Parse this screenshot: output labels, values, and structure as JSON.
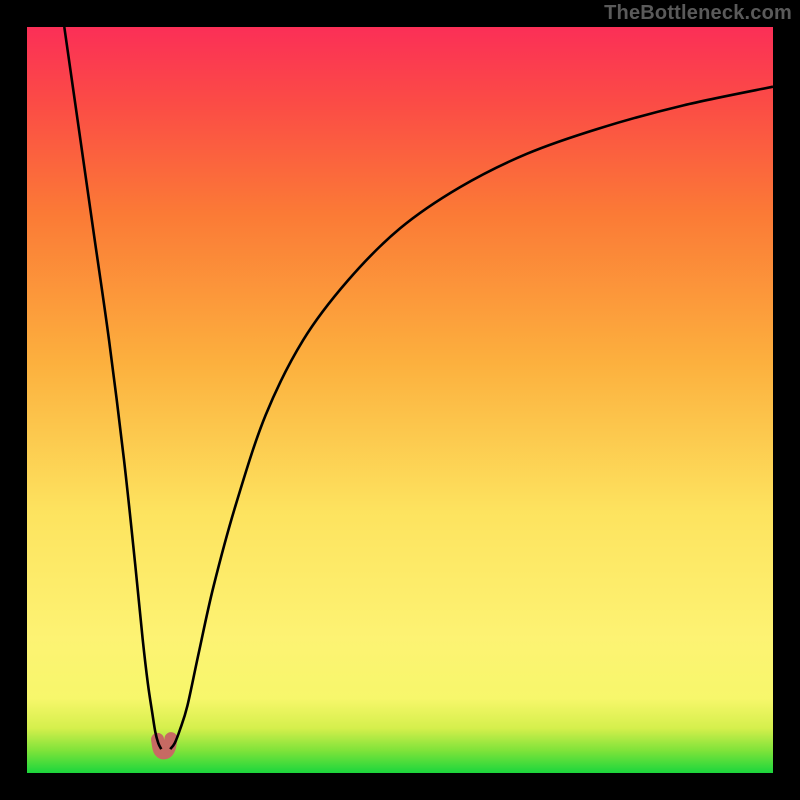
{
  "watermark": "TheBottleneck.com",
  "chart_data": {
    "type": "line",
    "title": "",
    "xlabel": "",
    "ylabel": "",
    "xlim": [
      0,
      100
    ],
    "ylim": [
      0,
      100
    ],
    "grid": false,
    "legend": false,
    "series": [
      {
        "name": "left-branch",
        "x": [
          5,
          7,
          9,
          11,
          13,
          14.5,
          15.5,
          16.2,
          16.8,
          17.2,
          17.6,
          18.0
        ],
        "y": [
          100,
          86,
          72,
          58,
          42,
          28,
          18,
          12,
          8,
          5.5,
          4,
          3.2
        ]
      },
      {
        "name": "right-branch",
        "x": [
          19.2,
          19.8,
          20.5,
          21.5,
          23,
          25,
          28,
          32,
          37,
          43,
          50,
          58,
          67,
          77,
          88,
          100
        ],
        "y": [
          3.2,
          4,
          5.8,
          9,
          16,
          25,
          36,
          48,
          58,
          66,
          73,
          78.5,
          83,
          86.5,
          89.5,
          92
        ]
      },
      {
        "name": "valley-u",
        "x": [
          17.5,
          17.7,
          18.0,
          18.4,
          18.8,
          19.1,
          19.3
        ],
        "y": [
          4.5,
          3.3,
          2.8,
          2.7,
          2.9,
          3.5,
          4.6
        ]
      }
    ],
    "colors": {
      "curve": "#000000",
      "valley_marker": "#c76a63",
      "gradient_stops": [
        {
          "offset": 0,
          "color": "#1bd63c"
        },
        {
          "offset": 3,
          "color": "#7fe33a"
        },
        {
          "offset": 6,
          "color": "#d5ef4c"
        },
        {
          "offset": 10,
          "color": "#f7f76b"
        },
        {
          "offset": 18,
          "color": "#fdf373"
        },
        {
          "offset": 35,
          "color": "#fde35f"
        },
        {
          "offset": 55,
          "color": "#fcb03e"
        },
        {
          "offset": 75,
          "color": "#fb7a36"
        },
        {
          "offset": 90,
          "color": "#fb4b46"
        },
        {
          "offset": 100,
          "color": "#fb2f57"
        }
      ]
    },
    "frame": {
      "outer": 800,
      "border": 27
    }
  }
}
